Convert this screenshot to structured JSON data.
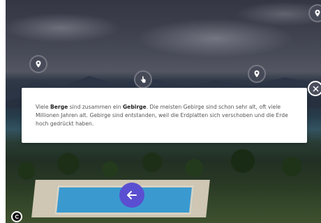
{
  "info_card": {
    "segments": [
      {
        "text": "Viele ",
        "bold": false
      },
      {
        "text": "Berge",
        "bold": true
      },
      {
        "text": " sind zusammen ein ",
        "bold": false
      },
      {
        "text": "Gebirge",
        "bold": true
      },
      {
        "text": ". Die meisten Gebirge sind schon sehr alt, oft viele Millionen Jahren alt. Gebirge sind entstanden, weil die Erdplatten sich verschoben und die Erde hoch gedrückt haben.",
        "bold": false
      }
    ]
  },
  "colors": {
    "back_button": "#5a4fd1",
    "hotspot": "#464a58",
    "card_background": "#ffffff"
  },
  "icons": {
    "close": "close-icon",
    "back": "arrow-left-icon",
    "hotspot": "location-pin-icon",
    "hand": "hand-pointer-icon",
    "logo": "c-logo-icon"
  }
}
